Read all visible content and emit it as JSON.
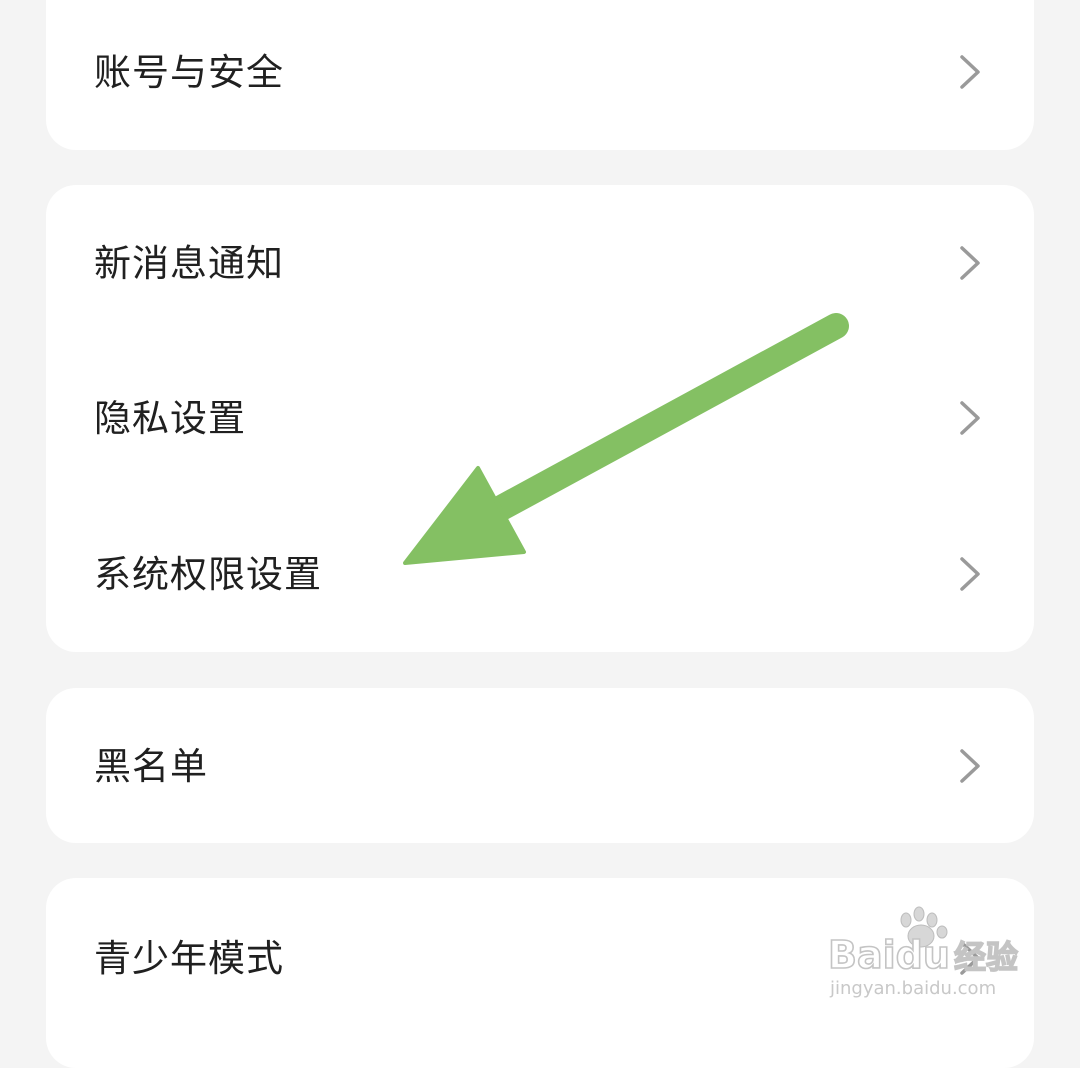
{
  "settings": {
    "groups": [
      {
        "items": [
          {
            "label": "账号与安全"
          }
        ]
      },
      {
        "items": [
          {
            "label": "新消息通知"
          },
          {
            "label": "隐私设置"
          },
          {
            "label": "系统权限设置"
          }
        ]
      },
      {
        "items": [
          {
            "label": "黑名单"
          }
        ]
      },
      {
        "items": [
          {
            "label": "青少年模式"
          }
        ]
      }
    ]
  },
  "annotation": {
    "arrow_color": "#84c063",
    "arrow_target": "系统权限设置"
  },
  "watermark": {
    "brand": "Baidu",
    "brand_suffix": "经验",
    "url": "jingyan.baidu.com"
  },
  "colors": {
    "background": "#f4f4f4",
    "card": "#ffffff",
    "text": "#202020",
    "chevron": "#9a9a9a"
  }
}
